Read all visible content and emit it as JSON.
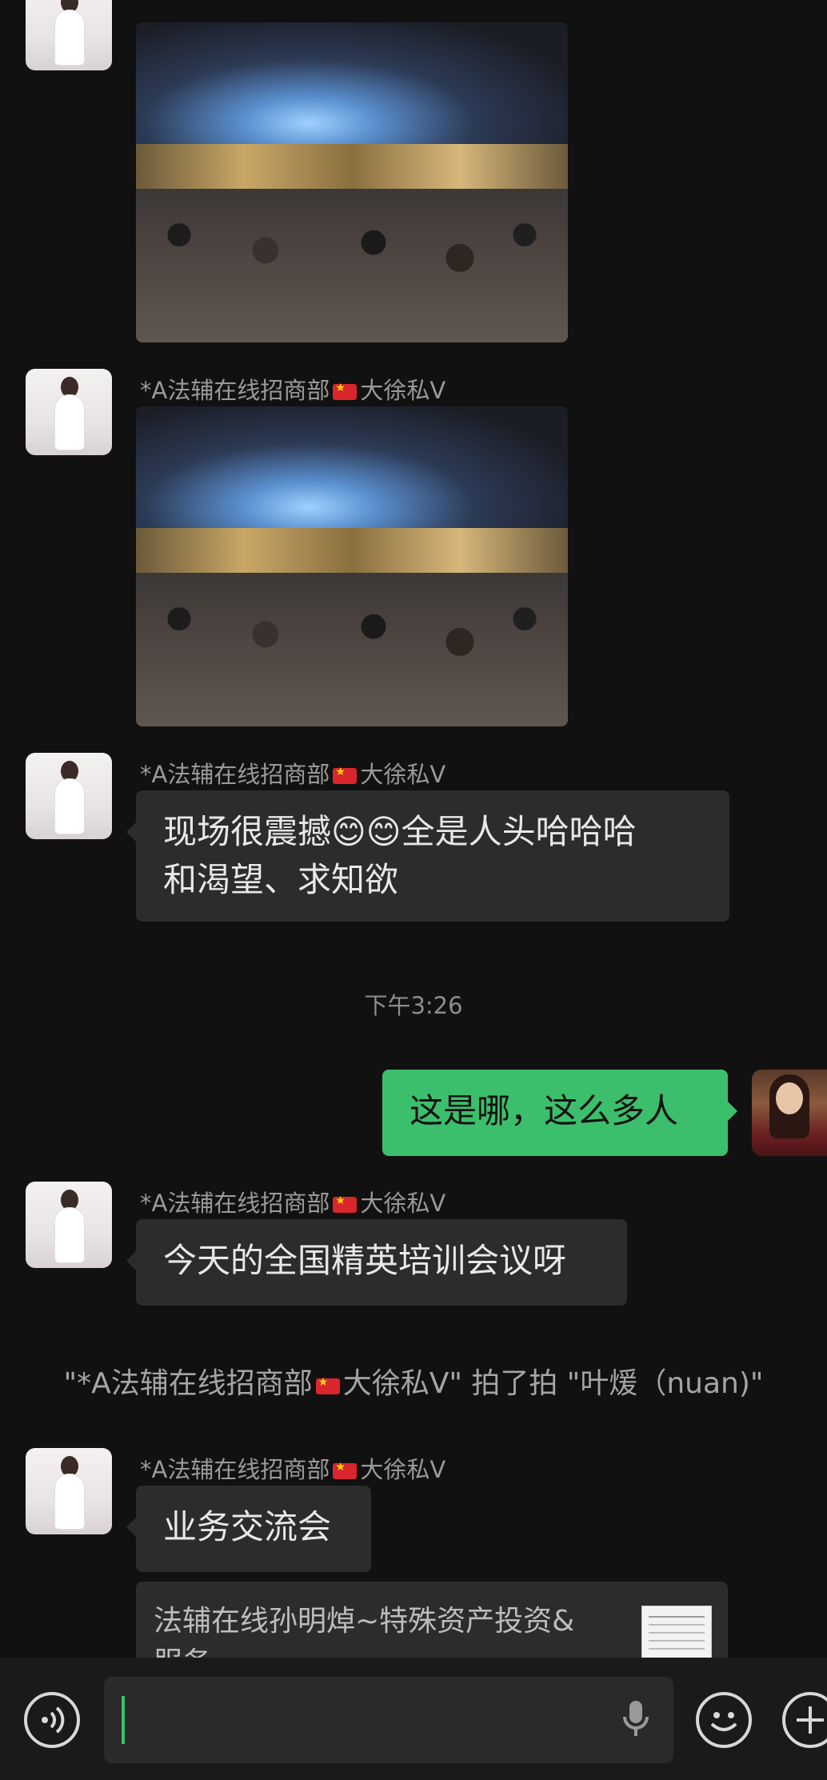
{
  "messages": [
    {
      "type": "image",
      "sender": "",
      "photo": "conference-hall-crowd-1"
    },
    {
      "type": "image",
      "sender_prefix": "*A法辅在线招商部",
      "sender_suffix": "大徐私V",
      "photo": "conference-hall-crowd-2"
    },
    {
      "type": "text",
      "sender_prefix": "*A法辅在线招商部",
      "sender_suffix": "大徐私V",
      "line1": "现场很震撼😊😊全是人头哈哈哈",
      "line2": "和渴望、求知欲"
    },
    {
      "type": "time",
      "text": "下午3:26"
    },
    {
      "type": "text",
      "from": "me",
      "text": "这是哪，这么多人"
    },
    {
      "type": "text",
      "sender_prefix": "*A法辅在线招商部",
      "sender_suffix": "大徐私V",
      "text": "今天的全国精英培训会议呀"
    },
    {
      "type": "system",
      "prefix": "\"*A法辅在线招商部",
      "suffix": "大徐私V\" 拍了拍 \"叶煖（nuan)\""
    },
    {
      "type": "text",
      "sender_prefix": "*A法辅在线招商部",
      "sender_suffix": "大徐私V",
      "text": "业务交流会"
    },
    {
      "type": "link_card",
      "title": "法辅在线孙明焯~特殊资产投资&服务"
    }
  ],
  "bottom_bar": {
    "left_icon": "voice-icon",
    "input_value": "",
    "mic_icon": "microphone-icon",
    "emoji_icon": "emoji-icon",
    "plus_icon": "plus-icon"
  },
  "colors": {
    "background": "#111111",
    "bubble": "#2c2c2c",
    "my_bubble": "#3cbf6c",
    "flag": "#d8262c"
  }
}
